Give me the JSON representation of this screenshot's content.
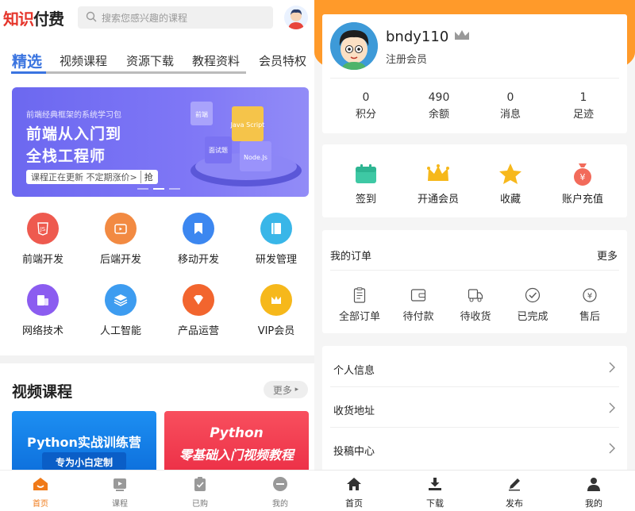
{
  "left": {
    "logo": {
      "part1": "知识",
      "part2": "付费"
    },
    "search": {
      "placeholder": "搜索您感兴趣的课程"
    },
    "tabs": [
      "精选",
      "视频课程",
      "资源下载",
      "教程资料",
      "会员特权"
    ],
    "banner": {
      "subtitle": "前端经典框架的系统学习包",
      "title_line1": "前端从入门到",
      "title_line2": "全栈工程师",
      "cta": "课程正在更新 不定期涨价>",
      "cta_action": "抢",
      "tags": [
        "前端",
        "Java Script",
        "面试题",
        "Node.Js"
      ]
    },
    "categories": [
      {
        "label": "前端开发",
        "icon": "html5-icon",
        "color": "#ee5a4f"
      },
      {
        "label": "后端开发",
        "icon": "tv-icon",
        "color": "#f28a42"
      },
      {
        "label": "移动开发",
        "icon": "bookmark-icon",
        "color": "#3c87f0"
      },
      {
        "label": "研发管理",
        "icon": "book-icon",
        "color": "#39b6e8"
      },
      {
        "label": "网络技术",
        "icon": "devices-icon",
        "color": "#8b5cf0"
      },
      {
        "label": "人工智能",
        "icon": "layers-icon",
        "color": "#3d9cf0"
      },
      {
        "label": "产品运营",
        "icon": "diamond-icon",
        "color": "#f2652e"
      },
      {
        "label": "VIP会员",
        "icon": "crown-icon",
        "color": "#f6b81b"
      }
    ],
    "section": {
      "title": "视频课程",
      "more": "更多"
    },
    "cards": [
      {
        "title": "Python实战训练营",
        "subtitle": "专为小白定制"
      },
      {
        "title": "Python",
        "subtitle": "零基础入门视频教程"
      }
    ],
    "nav": [
      {
        "label": "首页",
        "icon": "home-icon"
      },
      {
        "label": "课程",
        "icon": "video-icon"
      },
      {
        "label": "已购",
        "icon": "clipboard-check-icon"
      },
      {
        "label": "我的",
        "icon": "user-icon"
      }
    ]
  },
  "right": {
    "profile": {
      "username": "bndy110",
      "role": "注册会员"
    },
    "stats": [
      {
        "value": "0",
        "label": "积分"
      },
      {
        "value": "490",
        "label": "余额"
      },
      {
        "value": "0",
        "label": "消息"
      },
      {
        "value": "1",
        "label": "足迹"
      }
    ],
    "actions": [
      {
        "label": "签到",
        "icon": "calendar-icon"
      },
      {
        "label": "开通会员",
        "icon": "crown-icon"
      },
      {
        "label": "收藏",
        "icon": "star-icon"
      },
      {
        "label": "账户充值",
        "icon": "money-bag-icon"
      }
    ],
    "orders": {
      "title": "我的订单",
      "more": "更多",
      "items": [
        {
          "label": "全部订单",
          "icon": "list-icon"
        },
        {
          "label": "待付款",
          "icon": "wallet-icon"
        },
        {
          "label": "待收货",
          "icon": "truck-icon"
        },
        {
          "label": "已完成",
          "icon": "check-circle-icon"
        },
        {
          "label": "售后",
          "icon": "yen-icon"
        }
      ]
    },
    "menu": [
      "个人信息",
      "收货地址",
      "投稿中心"
    ],
    "nav": [
      {
        "label": "首页",
        "icon": "home-icon"
      },
      {
        "label": "下载",
        "icon": "download-icon"
      },
      {
        "label": "发布",
        "icon": "pen-icon"
      },
      {
        "label": "我的",
        "icon": "user-icon"
      }
    ]
  },
  "colors": {
    "accent_blue": "#3a74e0",
    "accent_orange": "#ff9a2a",
    "nav_active": "#f07a18"
  }
}
